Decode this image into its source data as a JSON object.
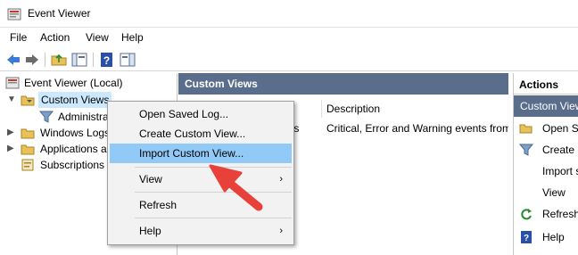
{
  "window": {
    "title": "Event Viewer"
  },
  "menu": [
    "File",
    "Action",
    "View",
    "Help"
  ],
  "tree": {
    "root": "Event Viewer (Local)",
    "custom_views": "Custom Views",
    "administrative": "Administra",
    "windows_logs": "Windows Logs",
    "apps_services": "Applications a",
    "subscriptions": "Subscriptions"
  },
  "center": {
    "header": "Custom Views",
    "col_description": "Description",
    "row_name_fragment": "ts",
    "row_description": "Critical, Error and Warning events from"
  },
  "actions": {
    "header": "Actions",
    "sub_header": "Custom View",
    "items": [
      "Open S",
      "Create C",
      "Import s",
      "View",
      "Refresh",
      "Help"
    ]
  },
  "context_menu": {
    "items": [
      "Open Saved Log...",
      "Create Custom View...",
      "Import Custom View...",
      "View",
      "Refresh",
      "Help"
    ],
    "highlighted_index": 2
  },
  "colors": {
    "panel_header": "#5a6e8c",
    "highlight": "#91c9f7",
    "arrow": "#e8413a"
  }
}
